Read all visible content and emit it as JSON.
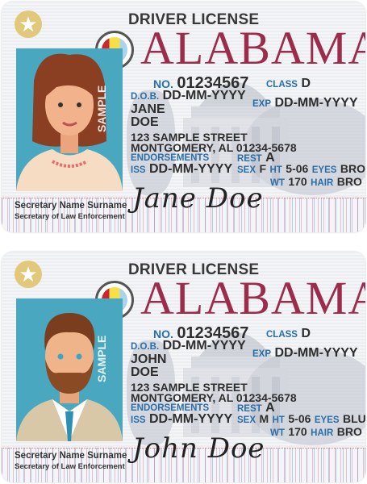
{
  "cards": [
    {
      "star_icon": "star-icon",
      "title": "DRIVER LICENSE",
      "state": "ALABAMA",
      "watermark": "SAMPLE",
      "no_label": "NO.",
      "no": "01234567",
      "class_label": "CLASS",
      "class": "D",
      "dob_label": "D.O.B.",
      "dob": "DD-MM-YYYY",
      "exp_label": "EXP",
      "exp": "DD-MM-YYYY",
      "first_name": "JANE",
      "last_name": "DOE",
      "address1": "123 SAMPLE STREET",
      "address2": "MONTGOMERY, AL 01234-5678",
      "endorsements_label": "ENDORSEMENTS",
      "rest_label": "REST",
      "rest": "A",
      "iss_label": "ISS",
      "iss": "DD-MM-YYYY",
      "sex_label": "SEX",
      "sex": "F",
      "ht_label": "HT",
      "ht": "5-06",
      "eyes_label": "EYES",
      "eyes": "BRO",
      "wt_label": "WT",
      "wt": "170",
      "hair_label": "HAIR",
      "hair": "BRO",
      "secretary_name": "Secretary Name Surname",
      "secretary_title": "Secretary of Law Enforcement",
      "signature": "Jane Doe",
      "gender": "female"
    },
    {
      "star_icon": "star-icon",
      "title": "DRIVER LICENSE",
      "state": "ALABAMA",
      "watermark": "SAMPLE",
      "no_label": "NO.",
      "no": "01234567",
      "class_label": "CLASS",
      "class": "D",
      "dob_label": "D.O.B.",
      "dob": "DD-MM-YYYY",
      "exp_label": "EXP",
      "exp": "DD-MM-YYYY",
      "first_name": "JOHN",
      "last_name": "DOE",
      "address1": "123 SAMPLE STREET",
      "address2": "MONTGOMERY, AL 01234-5678",
      "endorsements_label": "ENDORSEMENTS",
      "rest_label": "REST",
      "rest": "A",
      "iss_label": "ISS",
      "iss": "DD-MM-YYYY",
      "sex_label": "SEX",
      "sex": "M",
      "ht_label": "HT",
      "ht": "5-06",
      "eyes_label": "EYES",
      "eyes": "BLU",
      "wt_label": "WT",
      "wt": "170",
      "hair_label": "HAIR",
      "hair": "BRO",
      "secretary_name": "Secretary Name Surname",
      "secretary_title": "Secretary of Law Enforcement",
      "signature": "John Doe",
      "gender": "male"
    }
  ],
  "colors": {
    "state": "#9c2c4c",
    "label": "#2a6ea8",
    "photo_bg": "#49a8c0",
    "star": "#e1c87a"
  }
}
